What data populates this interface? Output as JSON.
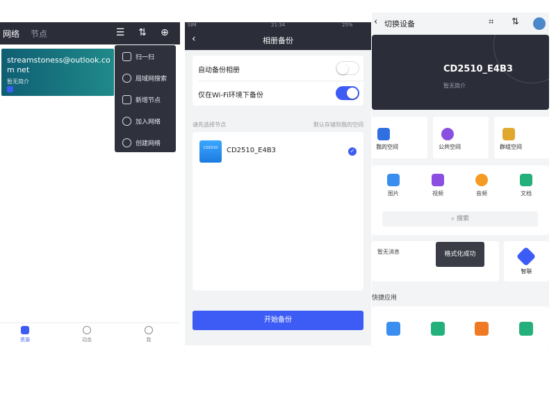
{
  "colors": {
    "dark_bar": "#2b2d38",
    "accent": "#3d5cf5",
    "teal_card": "#1f8a8a",
    "panel_bg": "#f2f3f5"
  },
  "panel1": {
    "tabs": [
      "网络",
      "节点"
    ],
    "toolbar_icons": [
      "menu-icon",
      "sort-icon",
      "add-icon"
    ],
    "network_card": {
      "email": "streamstoness@outlook.com net",
      "subtitle": "暂无简介",
      "checked": true
    },
    "dropdown_menu": [
      {
        "label": "扫一扫",
        "icon": "scan-icon"
      },
      {
        "label": "局域网搜索",
        "icon": "lan-search-icon"
      },
      {
        "label": "新增节点",
        "icon": "add-node-icon"
      },
      {
        "label": "加入网络",
        "icon": "join-network-icon"
      },
      {
        "label": "创建网络",
        "icon": "create-network-icon"
      }
    ],
    "bottom_nav": [
      {
        "label": "资源",
        "icon": "folder-icon",
        "active": true
      },
      {
        "label": "动态",
        "icon": "aperture-icon",
        "active": false
      },
      {
        "label": "我",
        "icon": "user-icon",
        "active": false
      }
    ]
  },
  "panel2": {
    "status_bar": {
      "left": "SIM",
      "center": "21:34",
      "right": "25%"
    },
    "nav_title": "相册备份",
    "settings": [
      {
        "label": "自动备份相册",
        "enabled": false
      },
      {
        "label": "仅在Wi-Fi环境下备份",
        "enabled": true
      }
    ],
    "select_hint": "请先选择节点",
    "storage_hint": "默认存储到我的空间",
    "node": {
      "icon_text": "CD2510",
      "name": "CD2510_E4B3",
      "selected": true
    },
    "start_button": "开始备份"
  },
  "panel3": {
    "header_title": "切换设备",
    "header_icons": [
      "scan-icon",
      "sort-icon",
      "avatar"
    ],
    "device_name": "CD2510_E4B3",
    "device_subtitle": "暂无简介",
    "spaces": [
      {
        "label": "我的空间",
        "icon": "my-space-icon",
        "color": "#2f6fe0"
      },
      {
        "label": "公共空间",
        "icon": "public-space-icon",
        "color": "#8a4fe0"
      },
      {
        "label": "群组空间",
        "icon": "group-space-icon",
        "color": "#e0a82f"
      }
    ],
    "media": [
      {
        "label": "图片",
        "icon": "image-icon",
        "color": "#3a8ef0"
      },
      {
        "label": "视频",
        "icon": "video-icon",
        "color": "#8a4fe0"
      },
      {
        "label": "音频",
        "icon": "audio-icon",
        "color": "#f59a23"
      },
      {
        "label": "文档",
        "icon": "document-icon",
        "color": "#23b07a"
      }
    ],
    "search_placeholder": "搜索",
    "message_text": "暂无消息",
    "toast": "格式化成功",
    "link_label": "智联",
    "quick_apps_title": "快捷应用",
    "quick_apps": [
      {
        "icon": "photo-app-icon",
        "color": "#3a8ef0"
      },
      {
        "icon": "contact-app-icon",
        "color": "#23b07a"
      },
      {
        "icon": "download-app-icon",
        "color": "#f07a23"
      },
      {
        "icon": "lock-app-icon",
        "color": "#23b07a"
      }
    ]
  }
}
